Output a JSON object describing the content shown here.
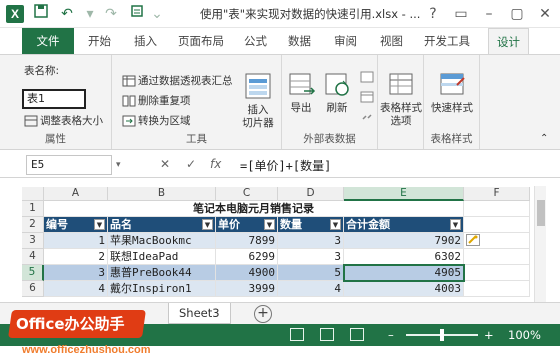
{
  "window": {
    "title": "使用\"表\"来实现对数据的快速引用.xlsx - ...",
    "app_icon": "X",
    "controls": [
      "?",
      "▭",
      "–",
      "▢",
      "✕"
    ]
  },
  "quick_access": [
    "save-icon",
    "undo-icon",
    "redo-icon",
    "customize-icon"
  ],
  "ribbon_tabs": [
    "文件",
    "开始",
    "插入",
    "页面布局",
    "公式",
    "数据",
    "审阅",
    "视图",
    "开发工具",
    "设计"
  ],
  "ribbon": {
    "properties": {
      "label_name": "表名称:",
      "table_name_value": "表1",
      "resize_label": "调整表格大小",
      "group_label": "属性"
    },
    "tools": {
      "pivot_label": "通过数据透视表汇总",
      "remove_dup_label": "删除重复项",
      "convert_label": "转换为区域",
      "slicer_label": "插入\n切片器",
      "group_label": "工具"
    },
    "external": {
      "export_label": "导出",
      "refresh_label": "刷新",
      "group_label": "外部表数据"
    },
    "style_options": {
      "label": "表格样式\n选项",
      "group_label": ""
    },
    "styles": {
      "label": "快速样式",
      "group_label": "表格样式"
    }
  },
  "formula_bar": {
    "cell_ref": "E5",
    "cancel": "✕",
    "enter": "✓",
    "fx": "fx",
    "formula": "=[单价]+[数量]"
  },
  "grid": {
    "columns": [
      "A",
      "B",
      "C",
      "D",
      "E",
      "F"
    ],
    "rows": [
      "1",
      "2",
      "3",
      "4",
      "5",
      "6"
    ],
    "title": "笔记本电脑元月销售记录",
    "headers": [
      "编号",
      "品名",
      "单价",
      "数量",
      "合计金额"
    ],
    "data": [
      [
        "1",
        "苹果MacBookmc",
        "7899",
        "3",
        "7902"
      ],
      [
        "2",
        "联想IdeaPad",
        "6299",
        "3",
        "6302"
      ],
      [
        "3",
        "惠普PreBook44",
        "4900",
        "5",
        "4905"
      ],
      [
        "4",
        "戴尔Inspiron1",
        "3999",
        "4",
        "4003"
      ]
    ],
    "selected_cell": "E5"
  },
  "sheet_tabs": {
    "visible": [
      "Sheet3"
    ],
    "add_symbol": "+"
  },
  "status_bar": {
    "zoom": "100%",
    "zoom_minus": "–",
    "zoom_plus": "+"
  },
  "watermark": {
    "badge": "Office办公助手",
    "url": "www.officezhushou.com"
  },
  "colors": {
    "excel_green": "#217346",
    "table_header": "#1f4e79",
    "band": "#dce6f1",
    "watermark": "#e03c14"
  }
}
